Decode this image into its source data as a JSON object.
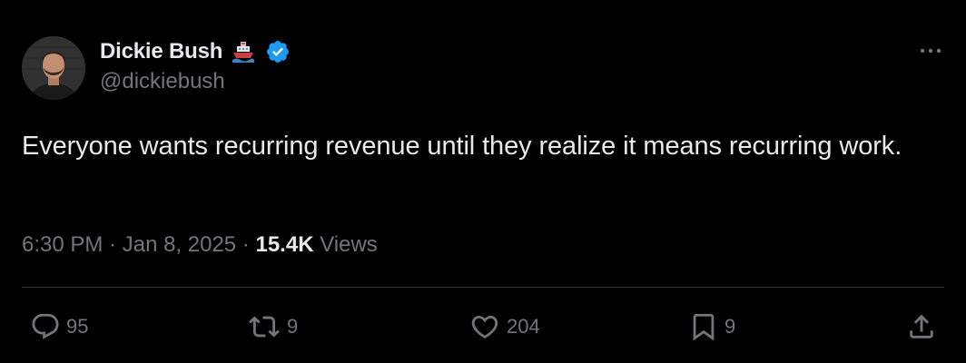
{
  "author": {
    "display_name": "Dickie Bush",
    "handle": "@dickiebush",
    "badge_emoji_icon": "ship-emoji-icon",
    "verified_icon": "verified-badge-icon",
    "verified_color": "#1d9bf0"
  },
  "more_icon": "more-horizontal-icon",
  "tweet": {
    "text": "Everyone wants recurring revenue until they realize it means recurring work."
  },
  "meta": {
    "time": "6:30 PM",
    "separator": " · ",
    "date": "Jan 8, 2025",
    "views_count": "15.4K",
    "views_label": " Views"
  },
  "actions": {
    "replies": {
      "icon": "reply-icon",
      "count": "95"
    },
    "reposts": {
      "icon": "repost-icon",
      "count": "9"
    },
    "likes": {
      "icon": "like-icon",
      "count": "204"
    },
    "bookmarks": {
      "icon": "bookmark-icon",
      "count": "9"
    },
    "share": {
      "icon": "share-icon"
    }
  },
  "colors": {
    "background": "#000000",
    "text_primary": "#e7e9ea",
    "text_secondary": "#71767b",
    "divider": "#2f3336"
  }
}
